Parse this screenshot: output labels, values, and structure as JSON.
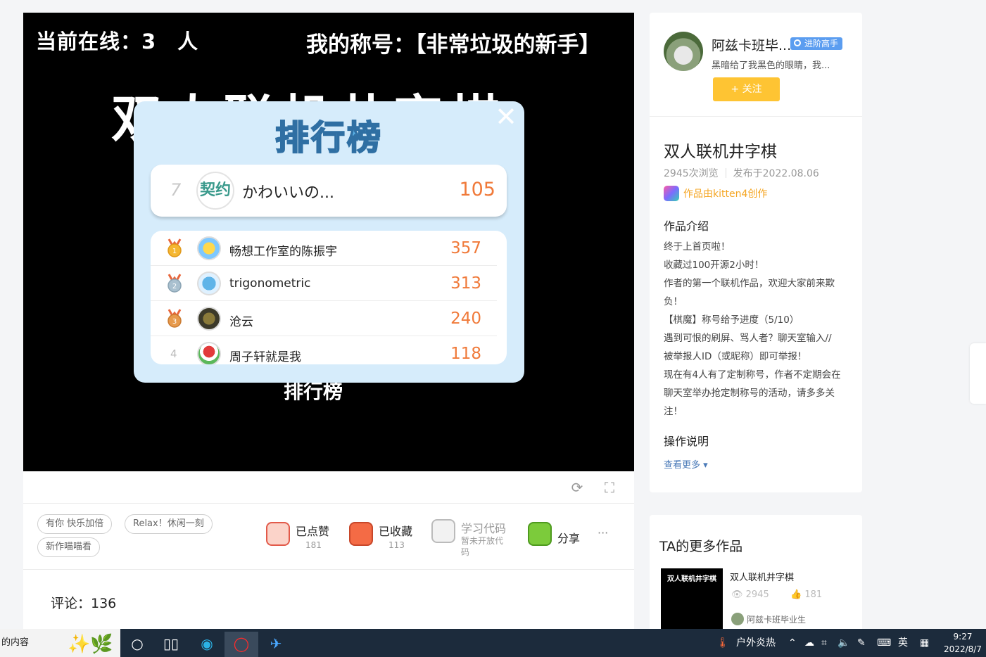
{
  "game": {
    "online_text": "当前在线：3　人",
    "my_title_text": "我的称号：【非常垃圾的新手】",
    "game_title": "双人联机井字棋",
    "under_button": "排行榜",
    "leaderboard": {
      "title": "排行榜",
      "close": "✕",
      "me": {
        "rank": "7",
        "avatar_text": "契约",
        "name": "かわいいの...",
        "score": "105"
      },
      "rows": [
        {
          "rank": "1",
          "name": "畅想工作室的陈振宇",
          "score": "357",
          "medal_color": "#f5b731"
        },
        {
          "rank": "2",
          "name": "trigonometric",
          "score": "313",
          "medal_color": "#a9c0cf"
        },
        {
          "rank": "3",
          "name": "沧云",
          "score": "240",
          "medal_color": "#e79a4c"
        },
        {
          "rank": "4",
          "name": "周子轩就是我",
          "score": "118",
          "medal_color": ""
        }
      ]
    }
  },
  "toolbar": {
    "refresh_icon": "refresh-icon",
    "fullscreen_icon": "fullscreen-icon"
  },
  "tags": [
    "有你 快乐加倍",
    "Relax！休闲一刻",
    "新作喵喵看"
  ],
  "actions": {
    "like": {
      "label": "已点赞",
      "count": "181"
    },
    "favorite": {
      "label": "已收藏",
      "count": "113"
    },
    "code": {
      "label": "学习代码",
      "sub1": "暂未开放代",
      "sub2": "码"
    },
    "share": {
      "label": "分享"
    },
    "more": "···"
  },
  "comments": {
    "label": "评论：136"
  },
  "author": {
    "name": "阿兹卡班毕...",
    "badge": "进阶高手",
    "motto": "黑暗给了我黑色的眼睛，我...",
    "follow": "+ 关注"
  },
  "work": {
    "title": "双人联机井字棋",
    "views": "2945次浏览",
    "published": "发布于2022.08.06",
    "tool": "作品由kitten4创作",
    "intro_heading": "作品介绍",
    "intro_lines": [
      "终于上首页啦！",
      "收藏过100开源2小时！",
      "作者的第一个联机作品，欢迎大家前来欺",
      "负！",
      "【棋魔】称号给予进度（5/10）",
      "遇到可恨的刷屏、骂人者？聊天室输入//",
      "被举报人ID（或昵称）即可举报！",
      "现在有4人有了定制称号，作者不定期会在",
      "聊天室举办抢定制称号的活动，请多多关",
      "注！"
    ],
    "ops_heading": "操作说明",
    "see_more": "查看更多 ▾"
  },
  "more_works": {
    "heading": "TA的更多作品",
    "thumb_text": "双人联机井字棋",
    "item_title": "双人联机井字棋",
    "views": "2945",
    "likes": "181",
    "author": "阿兹卡班毕业生"
  },
  "taskbar": {
    "search_text": "的内容",
    "weather": "户外炎热",
    "ime": "英",
    "time": "9:27",
    "date": "2022/8/7"
  }
}
